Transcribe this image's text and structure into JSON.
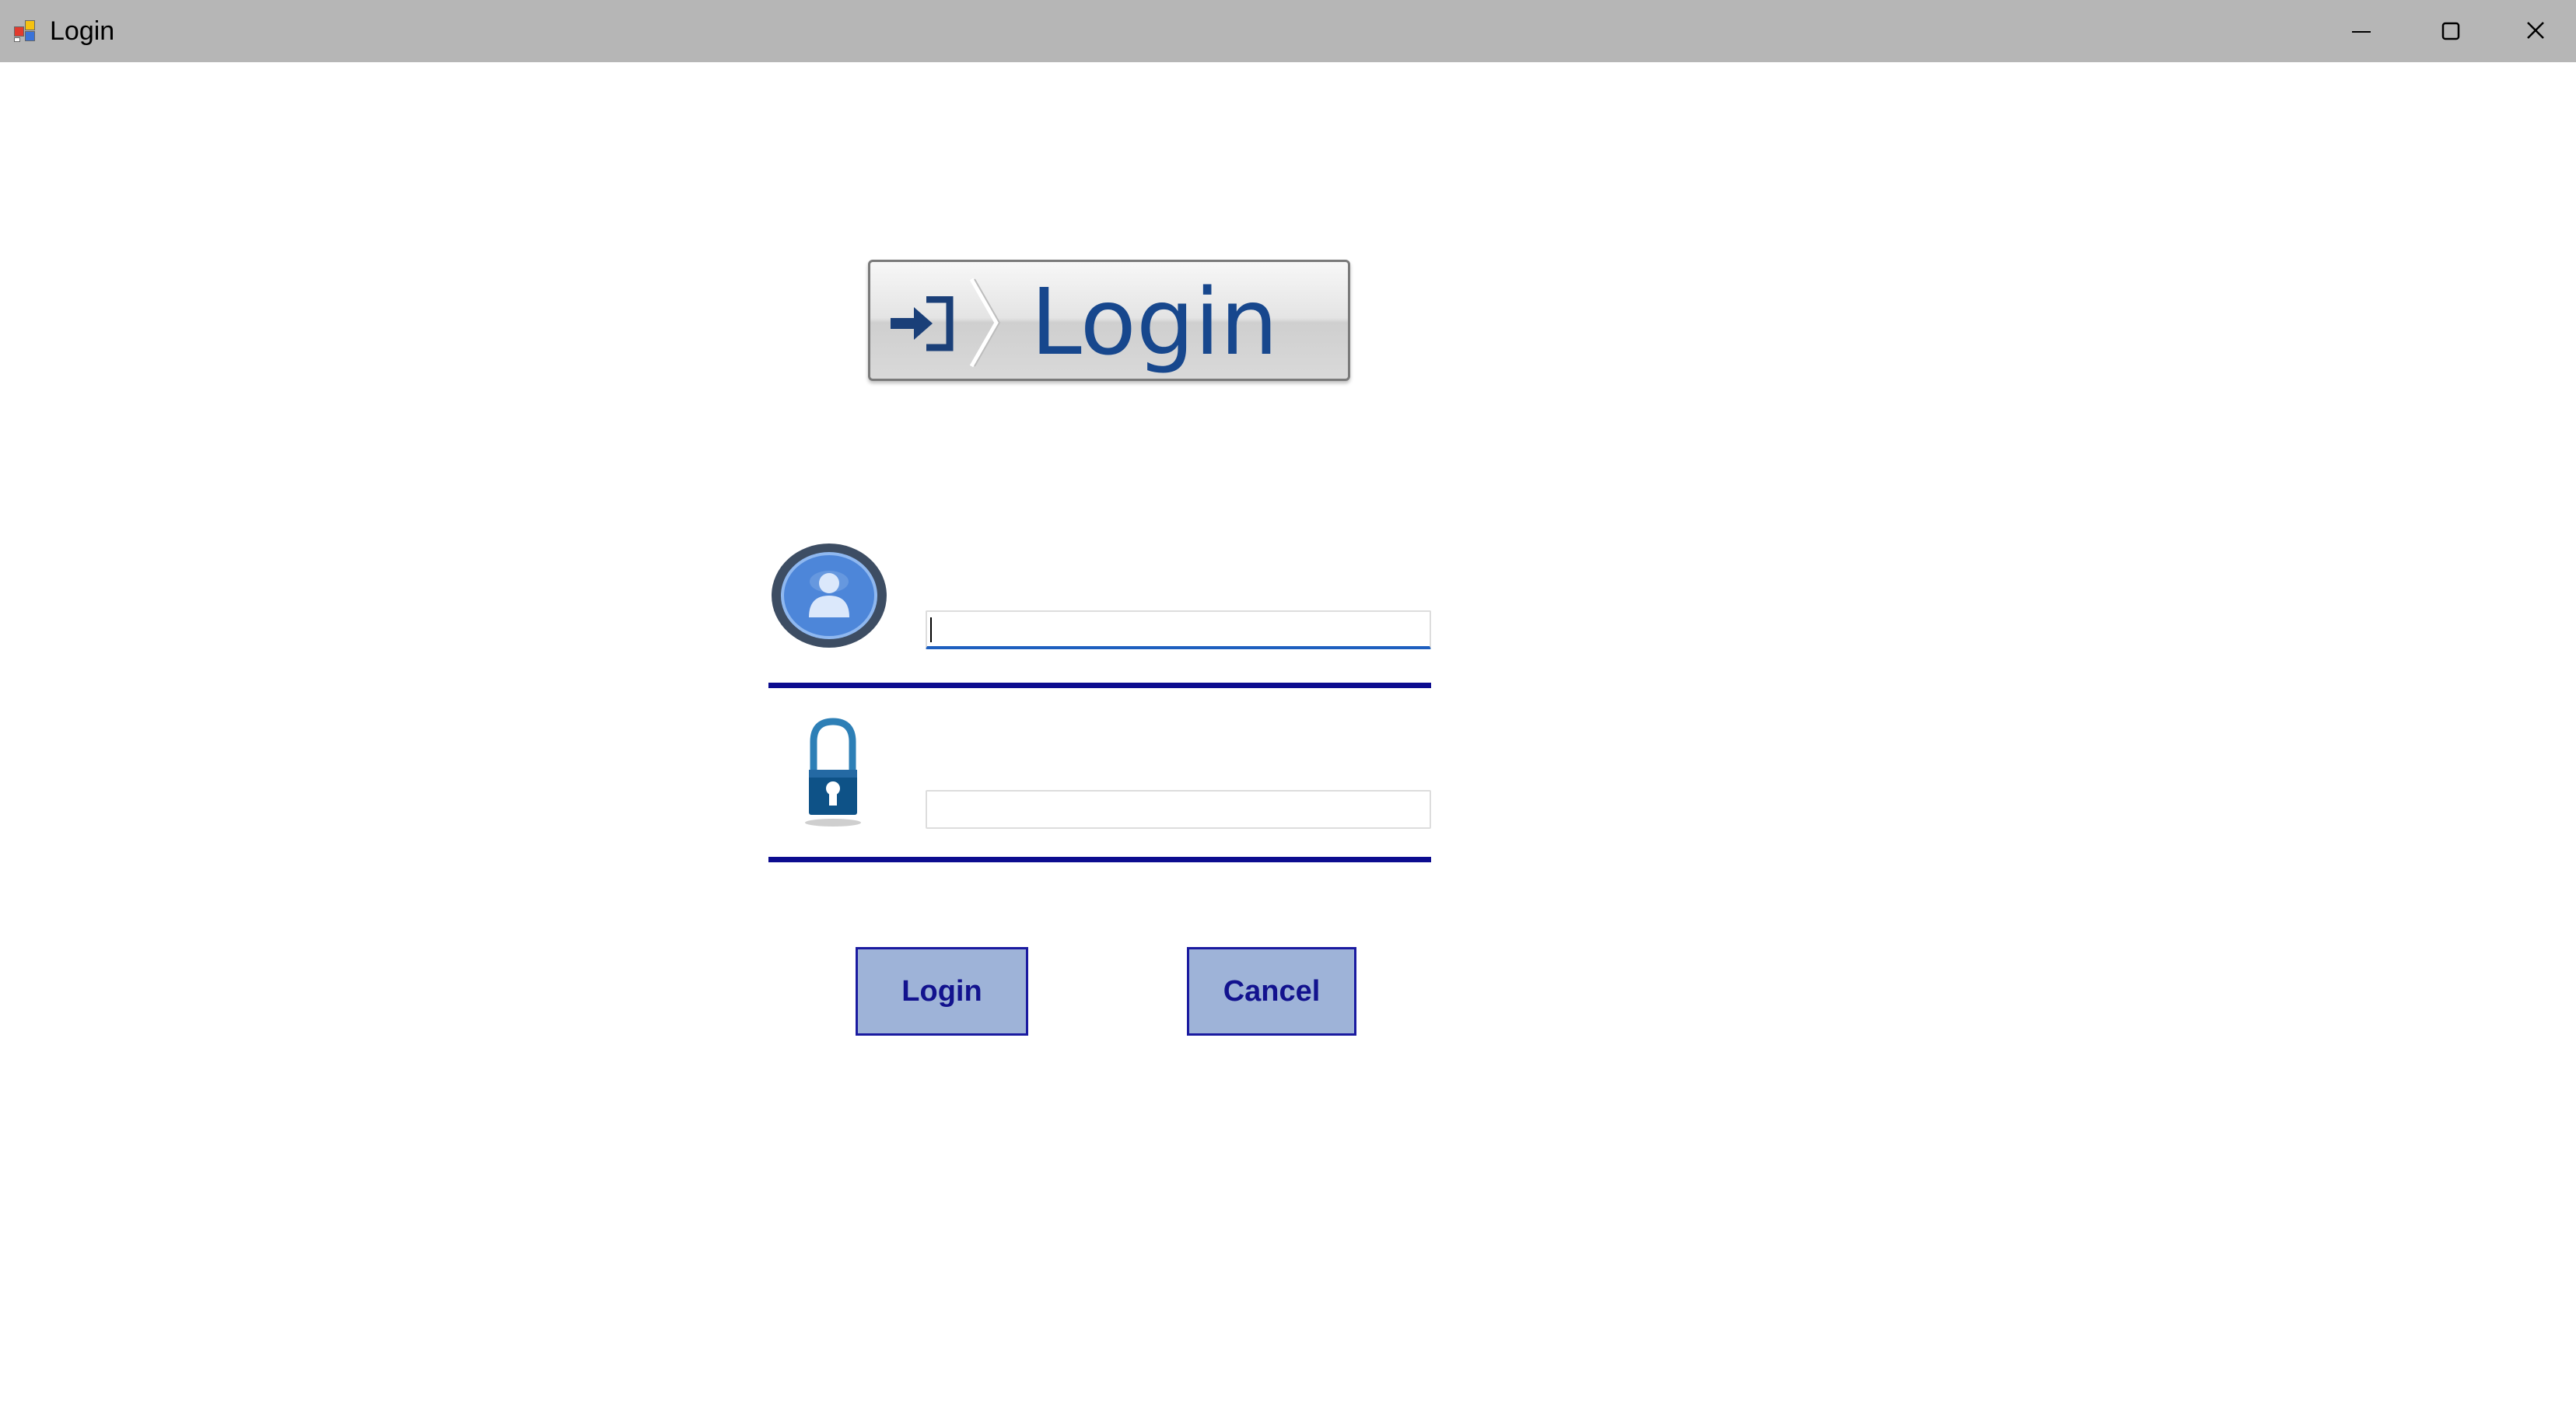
{
  "window": {
    "title": "Login",
    "app_icon": "windows-forms-app-icon",
    "controls": [
      "minimize-icon",
      "maximize-icon",
      "close-icon"
    ]
  },
  "banner": {
    "text": "Login",
    "icon": "sign-in-arrow-icon"
  },
  "form": {
    "username": {
      "icon": "user-avatar-icon",
      "value": "",
      "placeholder": "",
      "focused": true
    },
    "password": {
      "icon": "padlock-icon",
      "value": "",
      "placeholder": ""
    }
  },
  "buttons": {
    "login_label": "Login",
    "cancel_label": "Cancel"
  },
  "colors": {
    "title_bar": "#b6b6b6",
    "banner_text": "#17478d",
    "divider": "#0c0c8f",
    "button_fill": "#9eb3d8",
    "button_text": "#12128e",
    "focus_underline": "#1e5fbf"
  }
}
